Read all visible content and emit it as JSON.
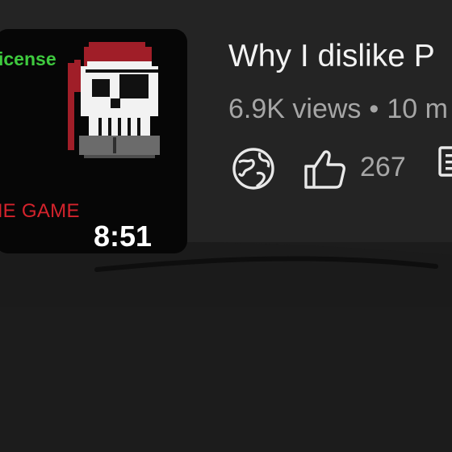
{
  "video": {
    "thumbnail_text_top": "icense",
    "thumbnail_text_bottom": "HE GAME",
    "duration": "8:51",
    "title": "Why I dislike P",
    "views": "6.9K views",
    "separator": "•",
    "age": "10 m",
    "likes": "267"
  },
  "icons": {
    "globe": "globe-icon",
    "like": "thumbs-up-icon",
    "partial": "document-icon",
    "thumbnail_art": "pirate-skull-icon"
  },
  "colors": {
    "thumbnail_green": "#3ec93e",
    "thumbnail_red": "#d4232c",
    "skull_bandana": "#a01e28"
  }
}
